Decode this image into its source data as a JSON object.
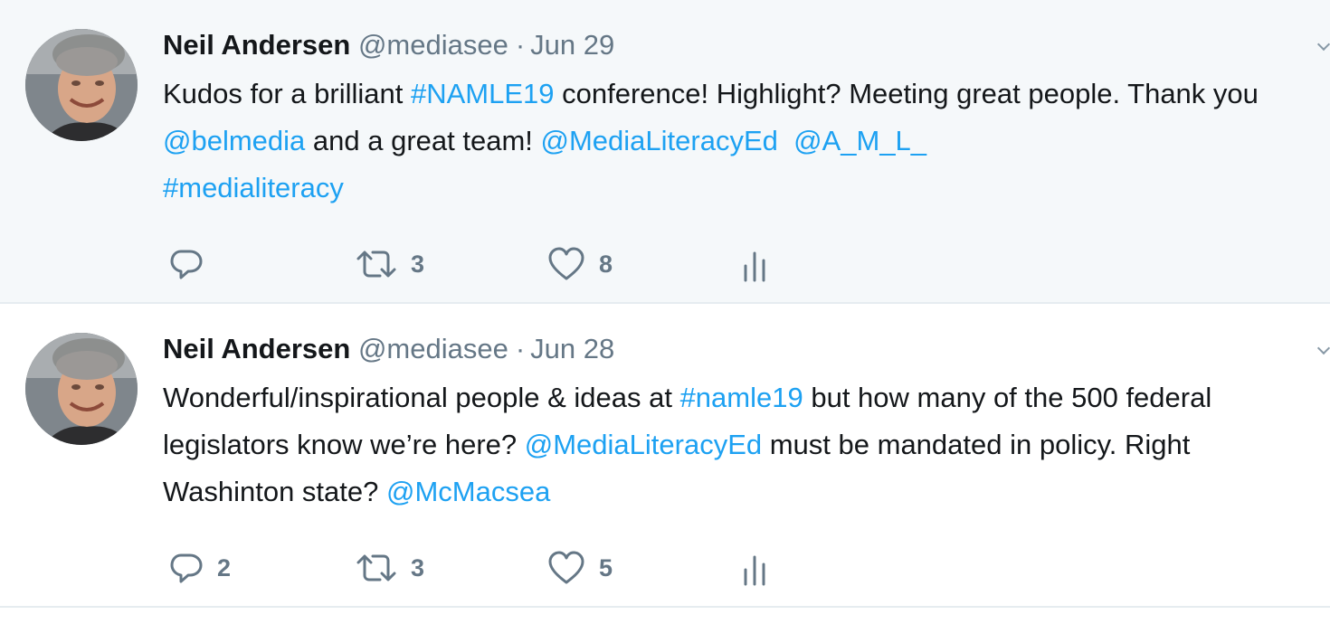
{
  "tweets": [
    {
      "author": {
        "name": "Neil Andersen",
        "handle": "@mediasee"
      },
      "separator": "·",
      "date": "Jun 29",
      "text": {
        "s0": "Kudos for a brilliant ",
        "s1": "#NAMLE19",
        "s2": " conference! Highlight? Meeting great people. Thank you ",
        "s3": "@belmedia",
        "s4": " and a great team! ",
        "s5": "@MediaLiteracyEd",
        "s6": "  ",
        "s7": "@A_M_L_",
        "s8": " ",
        "s9": "#medialiteracy"
      },
      "actions": {
        "reply_icon": "reply-icon",
        "reply_count": "",
        "retweet_icon": "retweet-icon",
        "retweet_count": "3",
        "like_icon": "heart-icon",
        "like_count": "8",
        "analytics_icon": "analytics-icon"
      }
    },
    {
      "author": {
        "name": "Neil Andersen",
        "handle": "@mediasee"
      },
      "separator": "·",
      "date": "Jun 28",
      "text": {
        "s0": "Wonderful/inspirational people & ideas at ",
        "s1": "#namle19",
        "s2": " but how many of the 500 federal legislators know we’re here? ",
        "s3": "@MediaLiteracyEd",
        "s4": " must be mandated in policy. Right Washinton state? ",
        "s5": "@McMacsea"
      },
      "actions": {
        "reply_icon": "reply-icon",
        "reply_count": "2",
        "retweet_icon": "retweet-icon",
        "retweet_count": "3",
        "like_icon": "heart-icon",
        "like_count": "5",
        "analytics_icon": "analytics-icon"
      }
    }
  ],
  "colors": {
    "link": "#1da1f2",
    "secondary_text": "#657786",
    "highlight_background": "#f5f8fa",
    "divider": "#e6ecf0"
  }
}
